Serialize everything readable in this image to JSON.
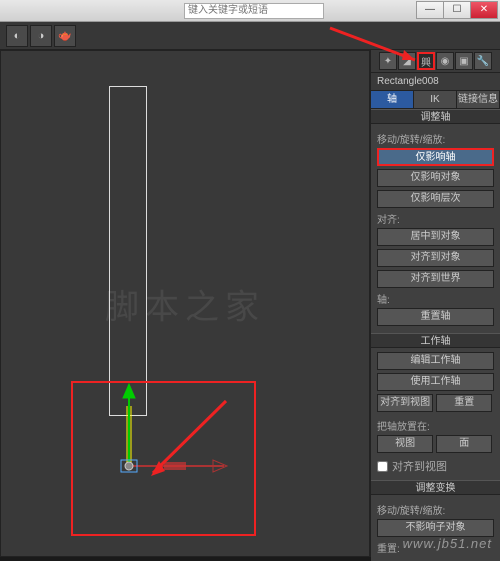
{
  "titlebar": {
    "search_placeholder": "键入关键字或短语"
  },
  "winbtns": {
    "min": "—",
    "max": "☐",
    "close": "✕"
  },
  "object": {
    "name": "Rectangle008"
  },
  "tabs": {
    "t1": "轴",
    "t2": "IK",
    "t3": "链接信息"
  },
  "rollouts": {
    "adjust_axis": "调整轴",
    "move_rot_scale": "移动/旋转/缩放:",
    "only_pivot": "仅影响轴",
    "only_object": "仅影响对象",
    "only_hier": "仅影响层次",
    "align": "对齐:",
    "center_obj": "居中到对象",
    "align_obj": "对齐到对象",
    "align_world": "对齐到世界",
    "axis": "轴:",
    "reset_axis": "重置轴",
    "work_axis": "工作轴",
    "edit_work": "编辑工作轴",
    "use_work": "使用工作轴",
    "align_view_btn": "对齐到视图",
    "reset_btn": "重置",
    "place_pivot": "把轴放置在:",
    "view": "视图",
    "surface": "面",
    "align_view_chk": "对齐到视图",
    "adjust_xform": "调整变换",
    "move_rot_scale2": "移动/旋转/缩放:",
    "no_child": "不影响子对象",
    "reset": "重置:"
  },
  "watermark": "www.jb51.net",
  "watermark2": "脚本之家"
}
